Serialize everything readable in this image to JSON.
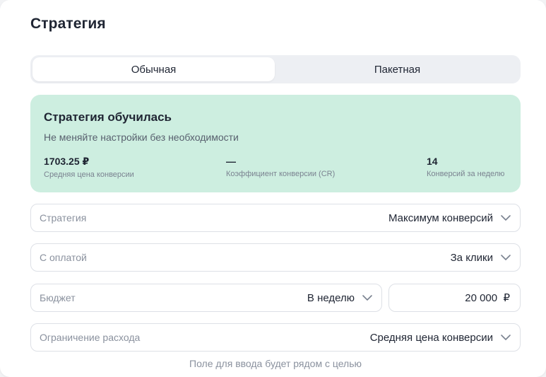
{
  "section": {
    "title": "Стратегия"
  },
  "tabs": [
    {
      "label": "Обычная",
      "active": true
    },
    {
      "label": "Пакетная",
      "active": false
    }
  ],
  "banner": {
    "title": "Стратегия обучилась",
    "subtitle": "Не меняйте настройки без необходимости",
    "metrics": [
      {
        "value": "1703.25 ₽",
        "label": "Средняя цена конверсии"
      },
      {
        "value": "—",
        "label": "Коэффициент конверсии (CR)"
      },
      {
        "value": "14",
        "label": "Конверсий за неделю"
      }
    ]
  },
  "fields": {
    "strategy": {
      "label": "Стратегия",
      "value": "Максимум конверсий"
    },
    "payment": {
      "label": "С оплатой",
      "value": "За клики"
    },
    "budget": {
      "label": "Бюджет",
      "period": "В неделю",
      "amount": "20 000  ₽"
    },
    "limit": {
      "label": "Ограничение расхода",
      "value": "Средняя цена конверсии"
    }
  },
  "hint": "Поле для ввода будет рядом с целью",
  "colors": {
    "banner_bg": "#cdeee0",
    "tabs_bg": "#edeff3",
    "border": "#dde0e6"
  }
}
